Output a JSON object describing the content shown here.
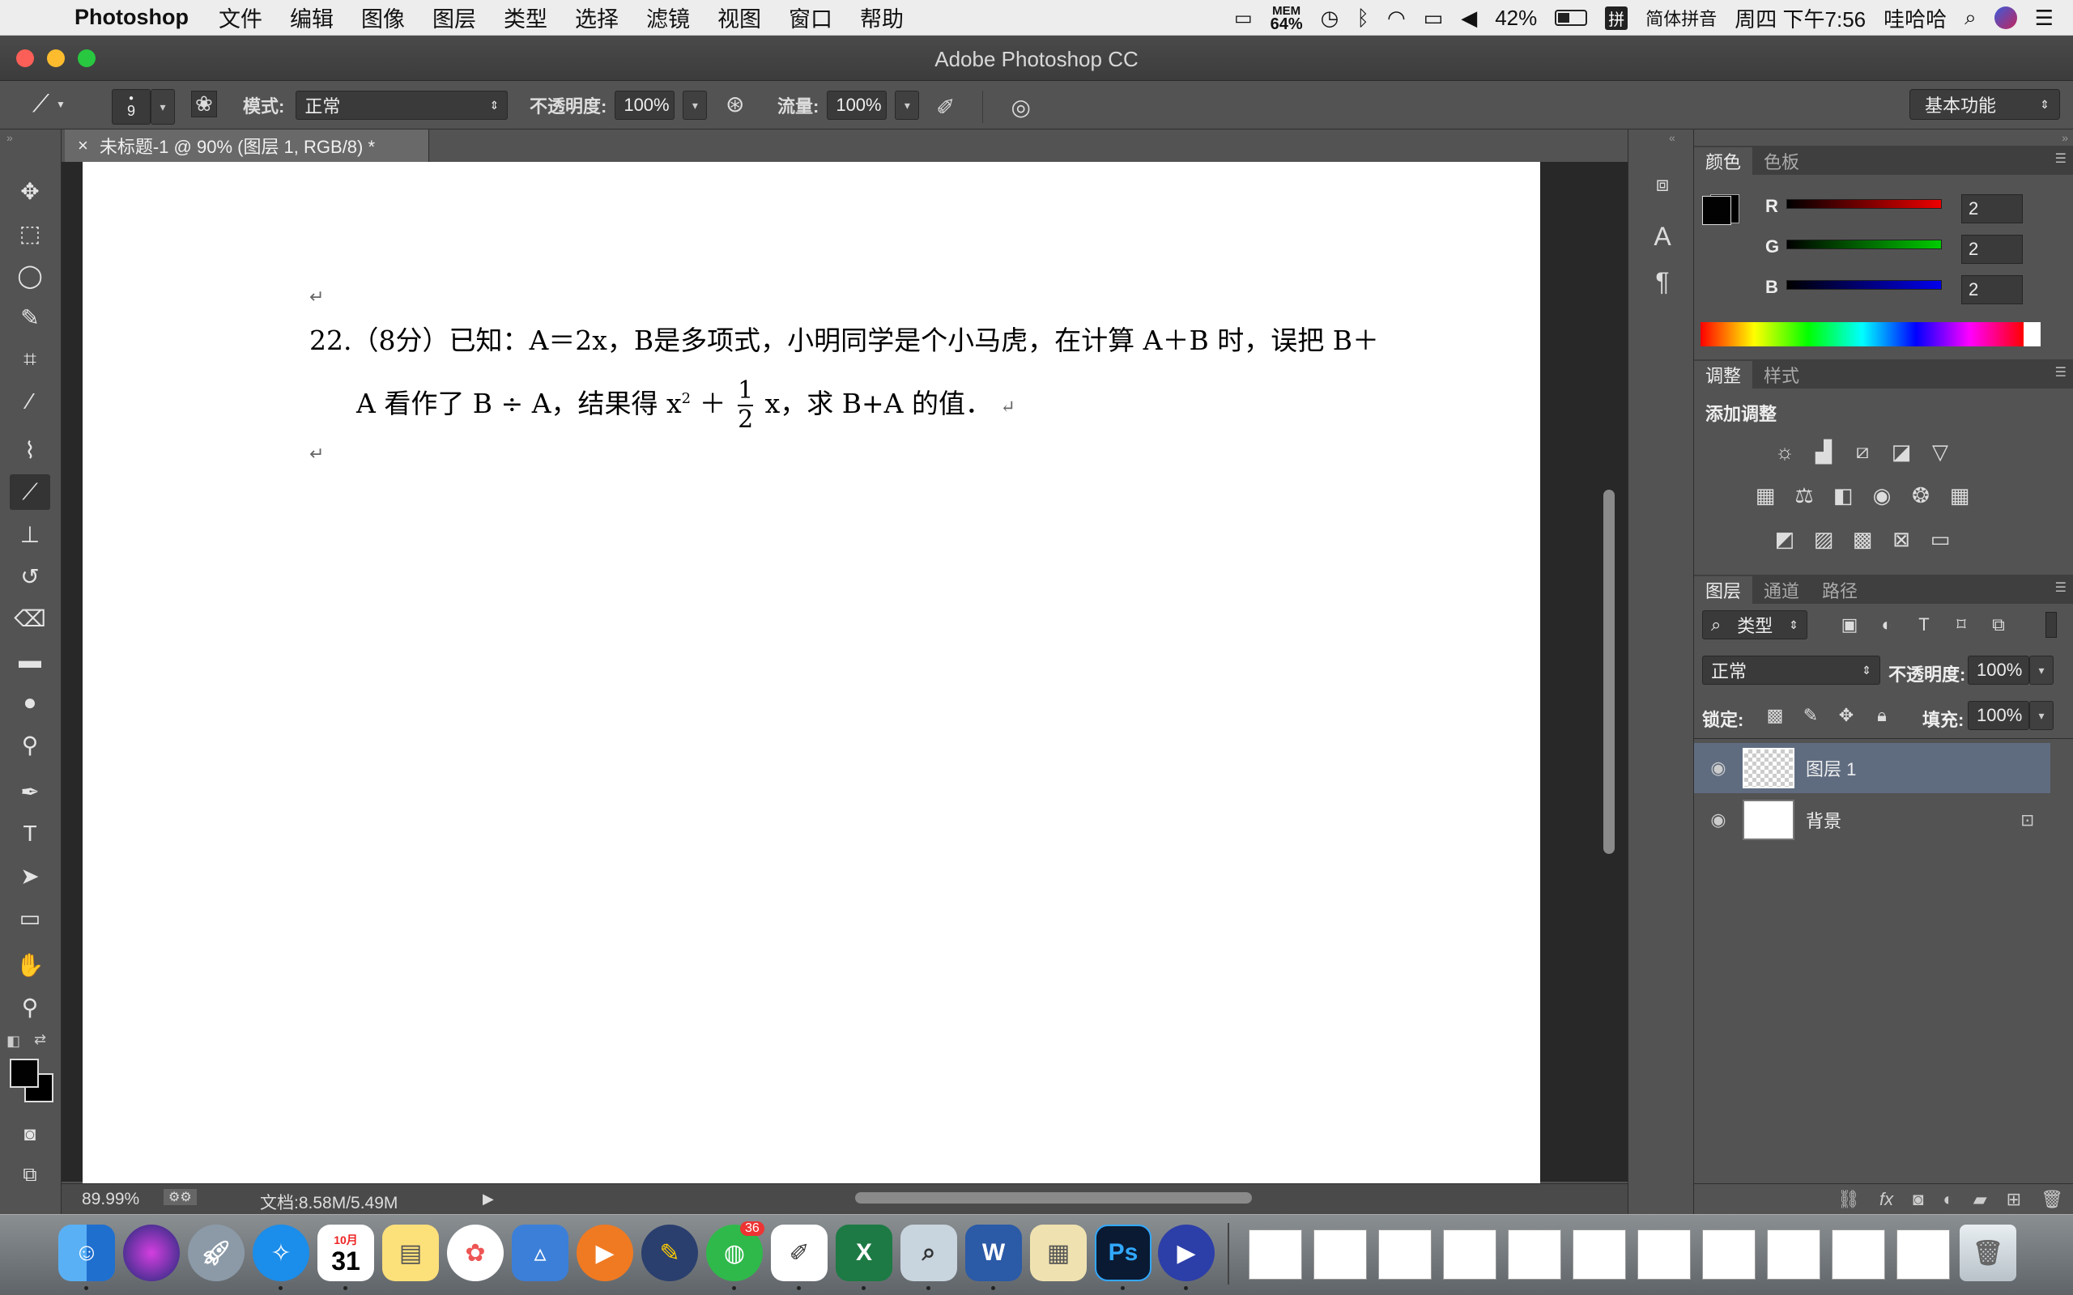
{
  "menubar": {
    "app_name": "Photoshop",
    "items": [
      "文件",
      "编辑",
      "图像",
      "图层",
      "类型",
      "选择",
      "滤镜",
      "视图",
      "窗口",
      "帮助"
    ],
    "mem_label": "MEM",
    "mem_value": "64%",
    "battery": "42%",
    "input_method_badge": "拼",
    "input_method": "简体拼音",
    "clock": "周四 下午7:56",
    "user": "哇哈哈"
  },
  "window": {
    "title": "Adobe Photoshop CC"
  },
  "options": {
    "brush_size": "9",
    "mode_label": "模式:",
    "mode_value": "正常",
    "opacity_label": "不透明度:",
    "opacity_value": "100%",
    "flow_label": "流量:",
    "flow_value": "100%",
    "workspace": "基本功能"
  },
  "document": {
    "tab_close": "×",
    "tab_title": "未标题-1 @ 90% (图层 1, RGB/8) *",
    "line1": "22.（8分）已知：A＝2x，B是多项式，小明同学是个小马虎，在计算 A＋B 时，误把 B＋",
    "line2a": "A 看作了 B ÷ A，结果得 x",
    "line2_sup": "2",
    "line2b": "＋",
    "frac_num": "1",
    "frac_den": "2",
    "line2c": "x，求 B+A 的值．",
    "return_mark": "↵"
  },
  "status": {
    "zoom": "89.99%",
    "doc_info": "文档:8.58M/5.49M"
  },
  "color_panel": {
    "tabs": [
      "颜色",
      "色板"
    ],
    "r_label": "R",
    "r_value": "2",
    "g_label": "G",
    "g_value": "2",
    "b_label": "B",
    "b_value": "2",
    "foreground": "#020202",
    "background": "#000000"
  },
  "adjust_panel": {
    "tabs": [
      "调整",
      "样式"
    ],
    "heading": "添加调整"
  },
  "layers_panel": {
    "tabs": [
      "图层",
      "通道",
      "路径"
    ],
    "filter_label": "类型",
    "blend_mode": "正常",
    "opacity_label": "不透明度:",
    "opacity_value": "100%",
    "lock_label": "锁定:",
    "fill_label": "填充:",
    "fill_value": "100%",
    "layers": [
      {
        "name": "图层 1",
        "selected": true
      },
      {
        "name": "背景",
        "selected": false,
        "locked": true
      }
    ]
  },
  "dock": {
    "calendar_month": "10月",
    "calendar_day": "31",
    "wechat_badge": "36",
    "ps_label": "Ps",
    "word_label": "W",
    "excel_label": "X"
  }
}
